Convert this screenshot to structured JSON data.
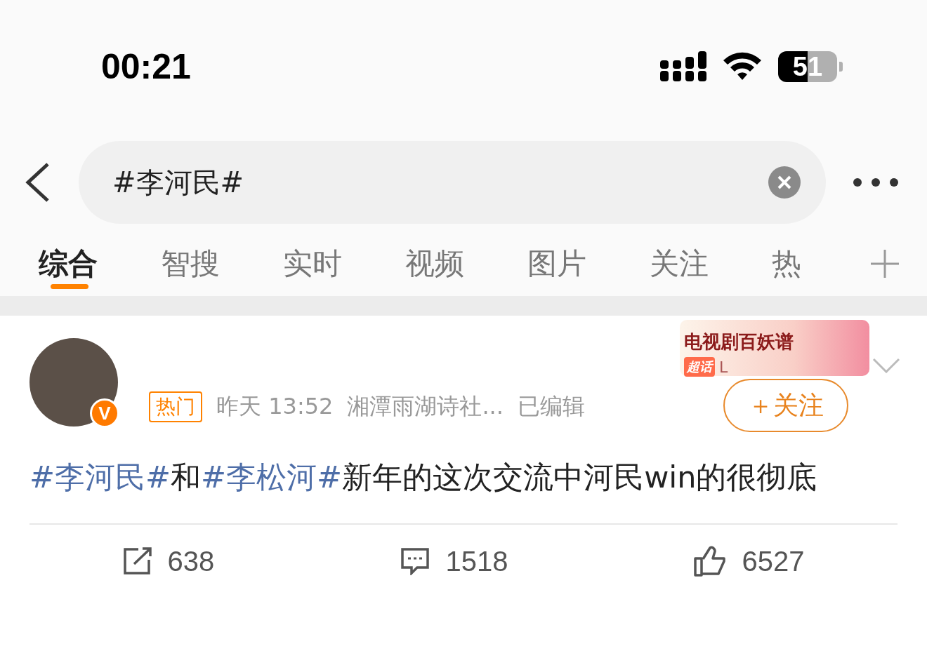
{
  "status_bar": {
    "time": "00:21",
    "battery": "51"
  },
  "search": {
    "value": "#李河民#"
  },
  "tabs": [
    {
      "label": "综合",
      "selected": true
    },
    {
      "label": "智搜",
      "selected": false
    },
    {
      "label": "实时",
      "selected": false
    },
    {
      "label": "视频",
      "selected": false
    },
    {
      "label": "图片",
      "selected": false
    },
    {
      "label": "关注",
      "selected": false
    },
    {
      "label": "热",
      "selected": false
    }
  ],
  "post": {
    "verified_badge": "V",
    "banner": {
      "title": "电视剧百妖谱",
      "tag": "超话",
      "level": "L"
    },
    "follow_button": "＋关注",
    "meta": {
      "tag": "热门",
      "time": "昨天 13:52",
      "source": "湘潭雨湖诗社...",
      "edited": "已编辑"
    },
    "text": [
      {
        "kind": "topic",
        "text": "#李河民#"
      },
      {
        "kind": "plain",
        "text": "和"
      },
      {
        "kind": "topic",
        "text": "#李松河#"
      },
      {
        "kind": "plain",
        "text": "新年的这次交流中河民win的很彻底"
      }
    ],
    "actions": {
      "reposts": "638",
      "comments": "1518",
      "likes": "6527"
    }
  }
}
